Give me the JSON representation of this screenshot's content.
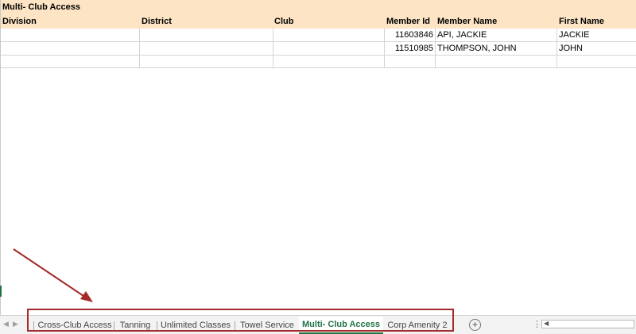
{
  "sheet": {
    "title": "Multi- Club Access",
    "columns": [
      "Division",
      "District",
      "Club",
      "Member Id",
      "Member Name",
      "First Name"
    ],
    "rows": [
      {
        "member_id": "11603846",
        "member_name": "API, JACKIE",
        "first_name": "JACKIE"
      },
      {
        "member_id": "11510985",
        "member_name": "THOMPSON, JOHN",
        "first_name": "JOHN"
      }
    ]
  },
  "tabs": {
    "items": [
      {
        "label": "Cross-Club Access"
      },
      {
        "label": "Tanning"
      },
      {
        "label": "Unlimited Classes"
      },
      {
        "label": "Towel Service"
      },
      {
        "label": "Multi- Club Access",
        "active": true
      },
      {
        "label": "Corp Amenity 2"
      }
    ],
    "add_icon": "plus-circle-icon",
    "prev_icon": "chevron-left-icon",
    "next_icon": "chevron-right-icon",
    "options_icon": "vertical-dots-icon"
  },
  "colors": {
    "header_fill": "#fce4c4",
    "active_tab": "#217346",
    "annotation": "#a52a2a"
  }
}
